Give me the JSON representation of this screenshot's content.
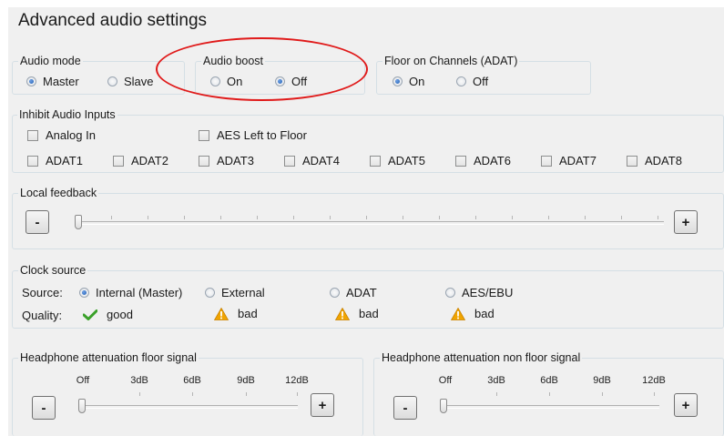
{
  "title": "Advanced audio settings",
  "audio_mode": {
    "label": "Audio mode",
    "options": [
      "Master",
      "Slave"
    ],
    "selected": "Master"
  },
  "audio_boost": {
    "label": "Audio boost",
    "options": [
      "On",
      "Off"
    ],
    "selected": "Off"
  },
  "floor_channels": {
    "label": "Floor on Channels (ADAT)",
    "options": [
      "On",
      "Off"
    ],
    "selected": "On"
  },
  "inhibit": {
    "label": "Inhibit Audio Inputs",
    "row1": [
      "Analog In",
      "AES Left to Floor"
    ],
    "row2": [
      "ADAT1",
      "ADAT2",
      "ADAT3",
      "ADAT4",
      "ADAT5",
      "ADAT6",
      "ADAT7",
      "ADAT8"
    ]
  },
  "local_feedback": {
    "label": "Local feedback",
    "minus": "-",
    "plus": "+",
    "value": 0
  },
  "clock": {
    "label": "Clock source",
    "source_label": "Source:",
    "quality_label": "Quality:",
    "sources": [
      "Internal (Master)",
      "External",
      "ADAT",
      "AES/EBU"
    ],
    "selected": "Internal (Master)",
    "qualities": [
      {
        "icon": "check-icon",
        "text": "good",
        "color": "#3aa12a"
      },
      {
        "icon": "warning-icon",
        "text": "bad",
        "color": "#f0a400"
      },
      {
        "icon": "warning-icon",
        "text": "bad",
        "color": "#f0a400"
      },
      {
        "icon": "warning-icon",
        "text": "bad",
        "color": "#f0a400"
      }
    ]
  },
  "hp_floor": {
    "label": "Headphone attenuation floor signal",
    "ticks": [
      "Off",
      "3dB",
      "6dB",
      "9dB",
      "12dB"
    ],
    "value": "Off",
    "minus": "-",
    "plus": "+"
  },
  "hp_nonfloor": {
    "label": "Headphone attenuation non floor signal",
    "ticks": [
      "Off",
      "3dB",
      "6dB",
      "9dB",
      "12dB"
    ],
    "value": "Off",
    "minus": "-",
    "plus": "+"
  },
  "annotation_color": "#e01a1a"
}
